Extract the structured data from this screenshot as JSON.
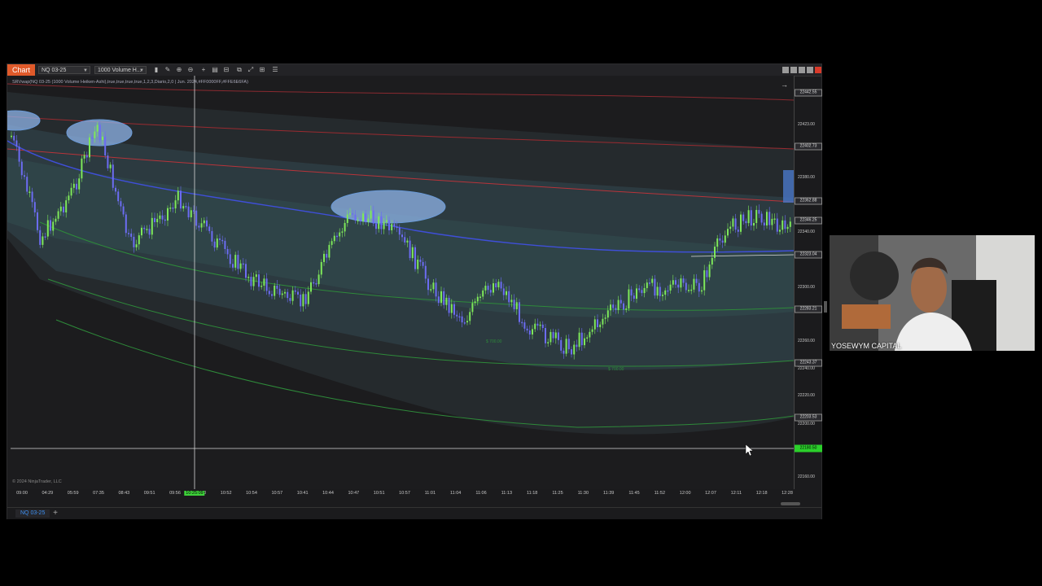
{
  "toolbar": {
    "chart_tab": "Chart",
    "instrument_select": "NQ 03-25",
    "bar_type_select": "1000 Volume H..."
  },
  "indicator_text": "SRVwap(NQ 03-25 (1000 Volume Heiken-Ashi),true,true,true,true,1,2,3,Diario,2,0 | Jun. 2024,#FF0000FF,#FFE6E6FA)",
  "copyright": "© 2024 NinjaTrader, LLC",
  "time_axis": {
    "labels": [
      "09:00",
      "04:29",
      "05:59",
      "07:35",
      "08:43",
      "09:51",
      "09:56",
      "10:50",
      "10:52",
      "10:54",
      "10:57",
      "10:41",
      "10:44",
      "10:47",
      "10:51",
      "10:57",
      "11:01",
      "11:04",
      "11:06",
      "11:13",
      "11:18",
      "11:25",
      "11:30",
      "11:39",
      "11:45",
      "11:52",
      "12:00",
      "12:07",
      "12:11",
      "12:18",
      "12:28"
    ],
    "highlighted": "10:25:09"
  },
  "price_axis": {
    "ticks": [
      "22423.00",
      "22380.00",
      "22340.00",
      "22300.00",
      "22260.00",
      "22240.00",
      "22220.00",
      "22200.00",
      "22160.00"
    ],
    "boxes": [
      "22442.55",
      "22402.73",
      "22362.88",
      "22346.25",
      "22323.04",
      "22283.21",
      "22243.37",
      "22203.53"
    ],
    "current": "22180.50"
  },
  "chart": {
    "markers": [
      "$ 700.00",
      "$ 700.00"
    ],
    "colors": {
      "up": "#7ee85a",
      "down": "#6c6cf2",
      "vwap": "#3f4fd8",
      "band_red": "#b8343a",
      "band_green": "#2e8a3a",
      "ellipse": "#8fb4e8"
    }
  },
  "bottom": {
    "instrument_tab": "NQ 03-25",
    "add_tab": "+"
  },
  "webcam": {
    "caption": "YOSEWYM CAPITAL"
  },
  "icons": [
    "bar-style-icon",
    "draw-icon",
    "zoom-icon",
    "crosshair-icon",
    "properties-icon",
    "strategies-icon",
    "indicators-icon",
    "chart-trader-icon",
    "window-icons"
  ]
}
